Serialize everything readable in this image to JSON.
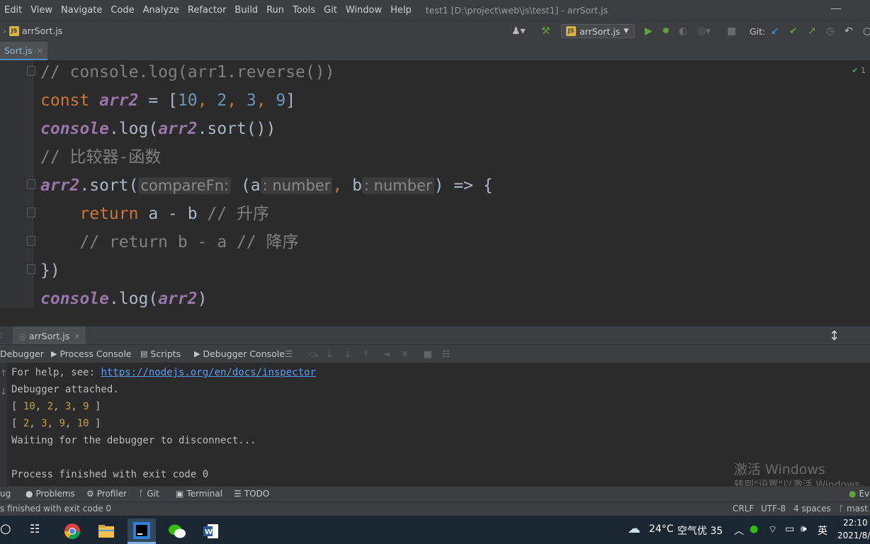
{
  "menu": {
    "items": [
      "Edit",
      "View",
      "Navigate",
      "Code",
      "Analyze",
      "Refactor",
      "Build",
      "Run",
      "Tools",
      "Git",
      "Window",
      "Help"
    ],
    "title": "test1 [D:\\project\\web\\js\\test1] - arrSort.js"
  },
  "nav": {
    "breadcrumb": "arrSort.js",
    "run_config": "arrSort.js",
    "git_label": "Git:"
  },
  "editor": {
    "tab": "Sort.js",
    "inspection_count": "1",
    "lines": [
      "// console.log(arr1.reverse())",
      "const arr2 = [10, 2, 3, 9]",
      "console.log(arr2.sort())",
      "// 比较器-函数",
      "arr2.sort(compareFn: (a: number, b: number) => {",
      "    return a - b // 升序",
      "    // return b - a // 降序",
      "})",
      "console.log(arr2)"
    ],
    "tokens": {
      "l1": "// console.log(arr1.reverse())",
      "l2_const": "const",
      "l2_var": "arr2",
      "l2_eq": " = [",
      "l2_n1": "10",
      "l2_n2": "2",
      "l2_n3": "3",
      "l2_n4": "9",
      "l2_end": "]",
      "l3_console": "console",
      "l3_log": ".log(",
      "l3_var": "arr2",
      "l3_end": ".sort())",
      "l4": "// 比较器-函数",
      "l5_var": "arr2",
      "l5_sort": ".sort(",
      "l5_hint": "compareFn:",
      "l5_a": " (a",
      "l5_hint_a": ": number",
      "l5_comma": ",",
      "l5_b": " b",
      "l5_hint_b": ": number",
      "l5_end": ") => {",
      "l6_ret": "return",
      "l6_expr": " a - b ",
      "l6_cm": "// 升序",
      "l7": "// return b - a // 降序",
      "l8": "})",
      "l9_console": "console",
      "l9_log": ".log(",
      "l9_var": "arr2",
      "l9_end": ")"
    }
  },
  "debug": {
    "tab": "arrSort.js",
    "subtabs": [
      "Debugger",
      "Process Console",
      "Scripts",
      "Debugger Console"
    ],
    "console": {
      "help_prefix": "For help, see: ",
      "help_link": "https://nodejs.org/en/docs/inspector",
      "attached": "Debugger attached.",
      "arr1": [
        "10",
        "2",
        "3",
        "9"
      ],
      "arr2": [
        "2",
        "3",
        "9",
        "10"
      ],
      "waiting": "Waiting for the debugger to disconnect...",
      "finished": "Process finished with exit code 0"
    }
  },
  "watermark": {
    "line1": "激活 Windows",
    "line2": "转到\"设置\"以激活 Windows。"
  },
  "toolwindows": [
    "ug",
    "Problems",
    "Profiler",
    "Git",
    "Terminal",
    "TODO"
  ],
  "event_log": "Ev",
  "status": {
    "message": "s finished with exit code 0",
    "line_sep": "CRLF",
    "encoding": "UTF-8",
    "indent": "4 spaces",
    "branch": "mast"
  },
  "taskbar": {
    "weather": "24°C",
    "air": "空气优 35",
    "ime": "英",
    "time": "22:10",
    "date": "2021/8/"
  }
}
